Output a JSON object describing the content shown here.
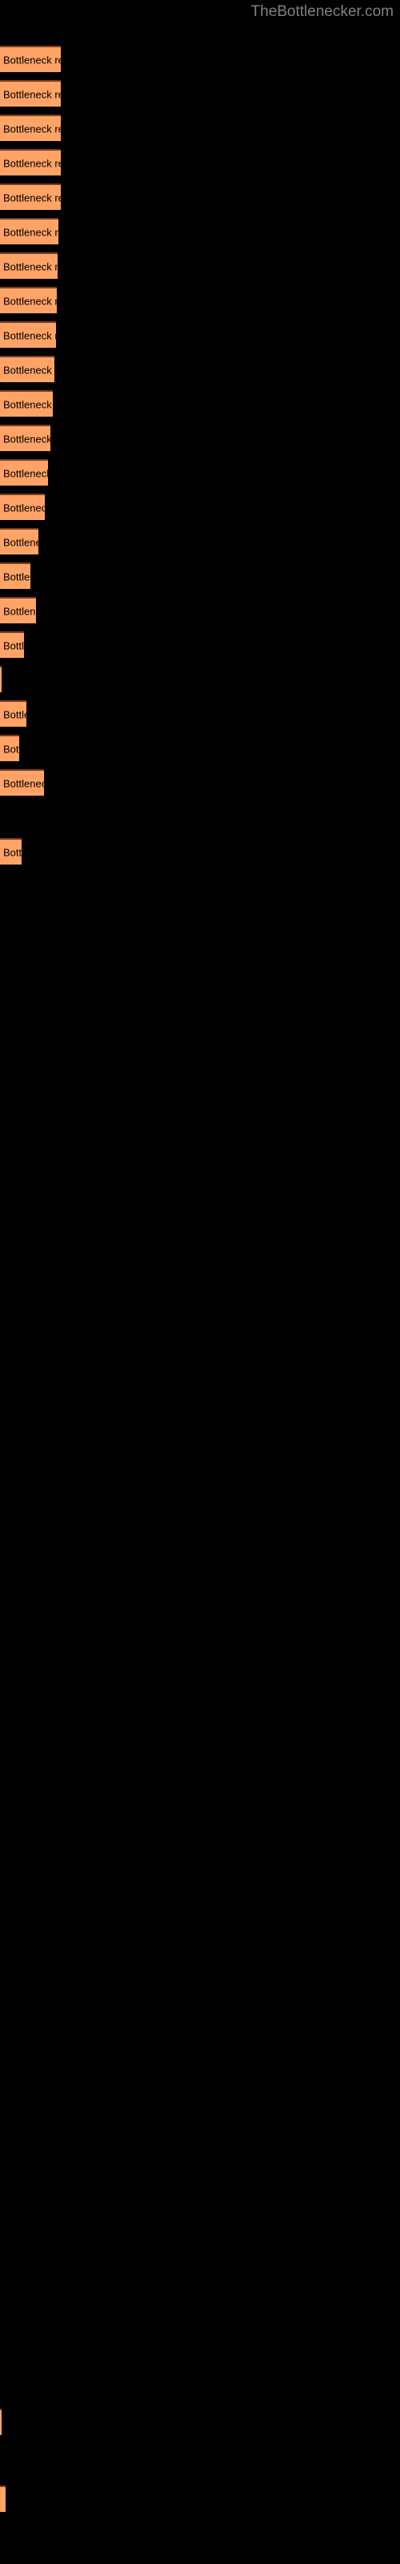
{
  "site": {
    "title": "TheBottlenecker.com",
    "title_color": "#808080"
  },
  "theme": {
    "background": "#000000",
    "bar_color": "#ffa366",
    "bar_border": "#7a3f1e",
    "label_color": "#000000"
  },
  "chart_data": {
    "type": "bar",
    "orientation": "horizontal",
    "title": "",
    "subtitle": "",
    "xlabel": "",
    "ylabel": "",
    "grid": false,
    "legend": null,
    "bar_label_text": "Bottleneck result",
    "axis_visible": false,
    "tick_labels": [],
    "xlim": [
      0,
      76
    ],
    "categories": [
      "Bottleneck result",
      "Bottleneck result",
      "Bottleneck result",
      "Bottleneck result",
      "Bottleneck result",
      "Bottleneck result",
      "Bottleneck result",
      "Bottleneck result",
      "Bottleneck result",
      "Bottleneck result",
      "Bottleneck result",
      "Bottleneck result",
      "Bottleneck result",
      "Bottleneck result",
      "Bottleneck result",
      "Bottleneck result",
      "Bottleneck result",
      "Bottleneck result",
      "Bottleneck result",
      "Bottleneck result",
      "Bottleneck result",
      "Bottleneck result",
      "Bottleneck result",
      "Bottleneck result",
      "Bottleneck result",
      "Bottleneck result"
    ],
    "values": [
      76,
      76,
      76,
      76,
      76,
      73,
      72,
      71,
      70,
      68,
      66,
      63,
      60,
      56,
      48,
      38,
      45,
      30,
      2,
      33,
      24,
      55,
      27,
      2,
      7
    ],
    "bars": [
      {
        "label": "Bottleneck result",
        "width": 76,
        "top": 57
      },
      {
        "label": "Bottleneck result",
        "width": 76,
        "top": 100
      },
      {
        "label": "Bottleneck result",
        "width": 76,
        "top": 143
      },
      {
        "label": "Bottleneck result",
        "width": 76,
        "top": 186
      },
      {
        "label": "Bottleneck result",
        "width": 76,
        "top": 229
      },
      {
        "label": "Bottleneck result",
        "width": 73,
        "top": 272
      },
      {
        "label": "Bottleneck result",
        "width": 72,
        "top": 315
      },
      {
        "label": "Bottleneck result",
        "width": 71,
        "top": 358
      },
      {
        "label": "Bottleneck result",
        "width": 70,
        "top": 401
      },
      {
        "label": "Bottleneck result",
        "width": 68,
        "top": 444
      },
      {
        "label": "Bottleneck result",
        "width": 66,
        "top": 487
      },
      {
        "label": "Bottleneck result",
        "width": 63,
        "top": 530
      },
      {
        "label": "Bottleneck result",
        "width": 60,
        "top": 573
      },
      {
        "label": "Bottleneck result",
        "width": 56,
        "top": 616
      },
      {
        "label": "Bottleneck result",
        "width": 48,
        "top": 659
      },
      {
        "label": "Bottleneck result",
        "width": 38,
        "top": 702
      },
      {
        "label": "Bottleneck result",
        "width": 45,
        "top": 745
      },
      {
        "label": "Bottleneck result",
        "width": 30,
        "top": 788
      },
      {
        "label": "",
        "width": 2,
        "top": 831
      },
      {
        "label": "Bottleneck result",
        "width": 33,
        "top": 874
      },
      {
        "label": "Bottleneck result",
        "width": 24,
        "top": 917
      },
      {
        "label": "Bottleneck result",
        "width": 55,
        "top": 960
      },
      {
        "label": "Bottleneck result",
        "width": 27,
        "top": 1046
      },
      {
        "label": "",
        "width": 2,
        "top": 3006
      },
      {
        "label": "",
        "width": 7,
        "top": 3102
      }
    ]
  }
}
